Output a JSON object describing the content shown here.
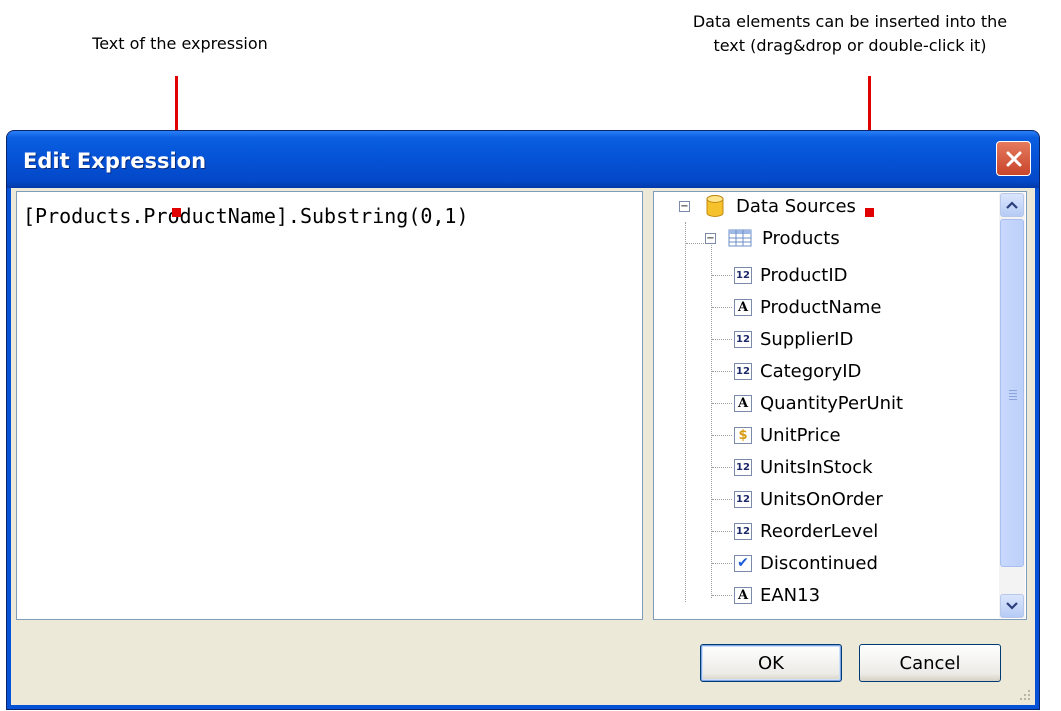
{
  "callouts": {
    "left": "Text of the expression",
    "right_line1": "Data elements can be inserted into the",
    "right_line2": "text (drag&drop or double-click it)"
  },
  "dialog": {
    "title": "Edit Expression",
    "expression": "[Products.ProductName].Substring(0,1)",
    "ok_label": "OK",
    "cancel_label": "Cancel"
  },
  "tree": {
    "root": {
      "label": "Data Sources",
      "icon": "database-icon"
    },
    "table": {
      "label": "Products",
      "icon": "table-icon"
    },
    "fields": [
      {
        "label": "ProductID",
        "icon": "number-field-icon",
        "glyph": "12"
      },
      {
        "label": "ProductName",
        "icon": "text-field-icon",
        "glyph": "A"
      },
      {
        "label": "SupplierID",
        "icon": "number-field-icon",
        "glyph": "12"
      },
      {
        "label": "CategoryID",
        "icon": "number-field-icon",
        "glyph": "12"
      },
      {
        "label": "QuantityPerUnit",
        "icon": "text-field-icon",
        "glyph": "A"
      },
      {
        "label": "UnitPrice",
        "icon": "currency-field-icon",
        "glyph": "$"
      },
      {
        "label": "UnitsInStock",
        "icon": "number-field-icon",
        "glyph": "12"
      },
      {
        "label": "UnitsOnOrder",
        "icon": "number-field-icon",
        "glyph": "12"
      },
      {
        "label": "ReorderLevel",
        "icon": "number-field-icon",
        "glyph": "12"
      },
      {
        "label": "Discontinued",
        "icon": "boolean-field-icon",
        "glyph": "✔"
      },
      {
        "label": "EAN13",
        "icon": "text-field-icon",
        "glyph": "A"
      }
    ]
  },
  "colors": {
    "accent": "#0552d6",
    "pointer": "#e00000",
    "close": "#c8452b"
  }
}
